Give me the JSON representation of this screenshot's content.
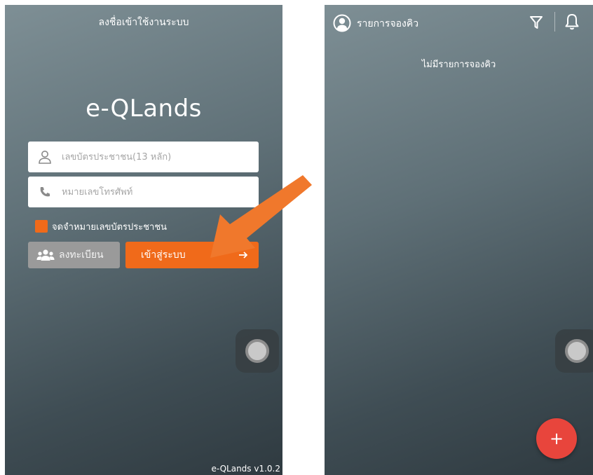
{
  "login": {
    "header_title": "ลงชื่อเข้าใช้งานระบบ",
    "app_title": "e-QLands",
    "idcard_placeholder": "เลขบัตรประชาชน(13 หลัก)",
    "phone_placeholder": "หมายเลขโทรศัพท์",
    "remember_label": "จดจำหมายเลขบัตรประชาชน",
    "register_label": "ลงทะเบียน",
    "login_label": "เข้าสู่ระบบ",
    "version": "e-QLands v1.0.2"
  },
  "queue": {
    "header_title": "รายการจองคิว",
    "empty_message": "ไม่มีรายการจองคิว",
    "fab_label": "+"
  },
  "icons": {
    "user": "user-icon",
    "phone": "phone-icon",
    "users": "users-icon",
    "arrow_right": "arrow-right-icon",
    "profile": "profile-icon",
    "filter": "filter-icon",
    "bell": "bell-icon",
    "assistive_touch": "assistive-touch-icon"
  },
  "colors": {
    "accent": "#f06a1a",
    "register_button": "#9a9a9a",
    "fab": "#e8453c",
    "background_top": "#7e8f95",
    "background_bottom": "#2f3a40"
  }
}
